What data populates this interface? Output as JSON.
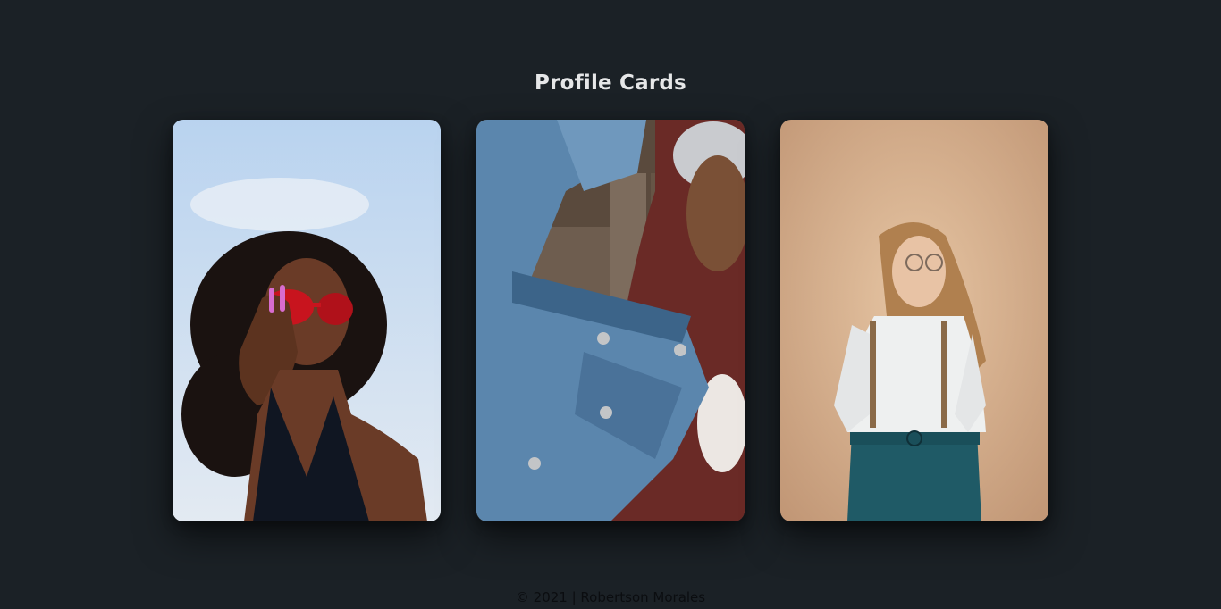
{
  "page": {
    "title": "Profile Cards",
    "footer": "© 2021 | Robertson Morales"
  },
  "cards": [
    {
      "subject": "woman-red-sunglasses",
      "colors": {
        "sky_top": "#b9d3ef",
        "sky_bottom": "#dfe8f2",
        "skin": "#6a3b27",
        "hair": "#1a1210",
        "glasses": "#c8141e",
        "top": "#101622"
      }
    },
    {
      "subject": "man-denim-jacket",
      "colors": {
        "denim": "#5b86ad",
        "denim_dark": "#3c6489",
        "hoodie": "#6a2a26",
        "skin": "#7a5036",
        "beanie": "#c9cbcf",
        "wood": "#6e5d4f"
      }
    },
    {
      "subject": "woman-white-shirt",
      "colors": {
        "bg_top": "#c9a27e",
        "bg_bottom": "#e6c5a3",
        "shirt": "#eef0f0",
        "hair": "#b0804f",
        "jeans": "#1f5a66",
        "skin": "#e8c3a5"
      }
    }
  ]
}
